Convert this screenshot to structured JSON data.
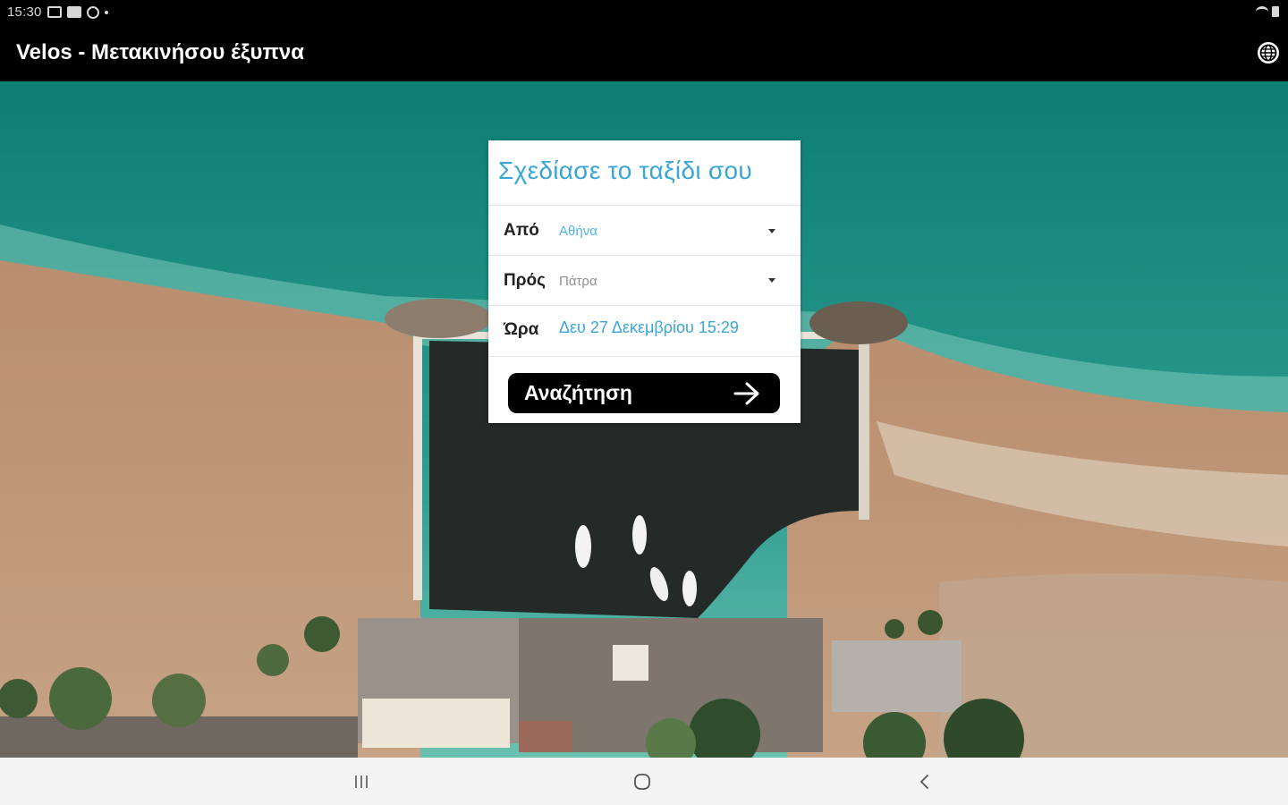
{
  "status_bar": {
    "time": "15:30",
    "left_icons": [
      "gallery-icon",
      "mail-icon",
      "a-icon",
      "dot-icon"
    ],
    "right_icons": [
      "wifi-icon",
      "battery-icon"
    ]
  },
  "app_bar": {
    "title": "Velos - Μετακινήσου έξυπνα",
    "language_icon": "globe-icon"
  },
  "trip_card": {
    "title": "Σχεδίασε το ταξίδι σου",
    "from_label": "Από",
    "from_value": "Αθήνα",
    "to_label": "Πρός",
    "to_value": "Πάτρα",
    "time_label": "Ώρα",
    "time_value": "Δευ 27 Δεκεμβρίου 15:29",
    "search_label": "Αναζήτηση"
  },
  "nav_bar": {
    "icons": [
      "recent-apps-icon",
      "home-icon",
      "back-icon"
    ]
  },
  "colors": {
    "accent_blue": "#3aa6d8",
    "placeholder_blue": "#4fb3e4",
    "placeholder_gray": "#8e8e8e",
    "button_black": "#000000"
  }
}
